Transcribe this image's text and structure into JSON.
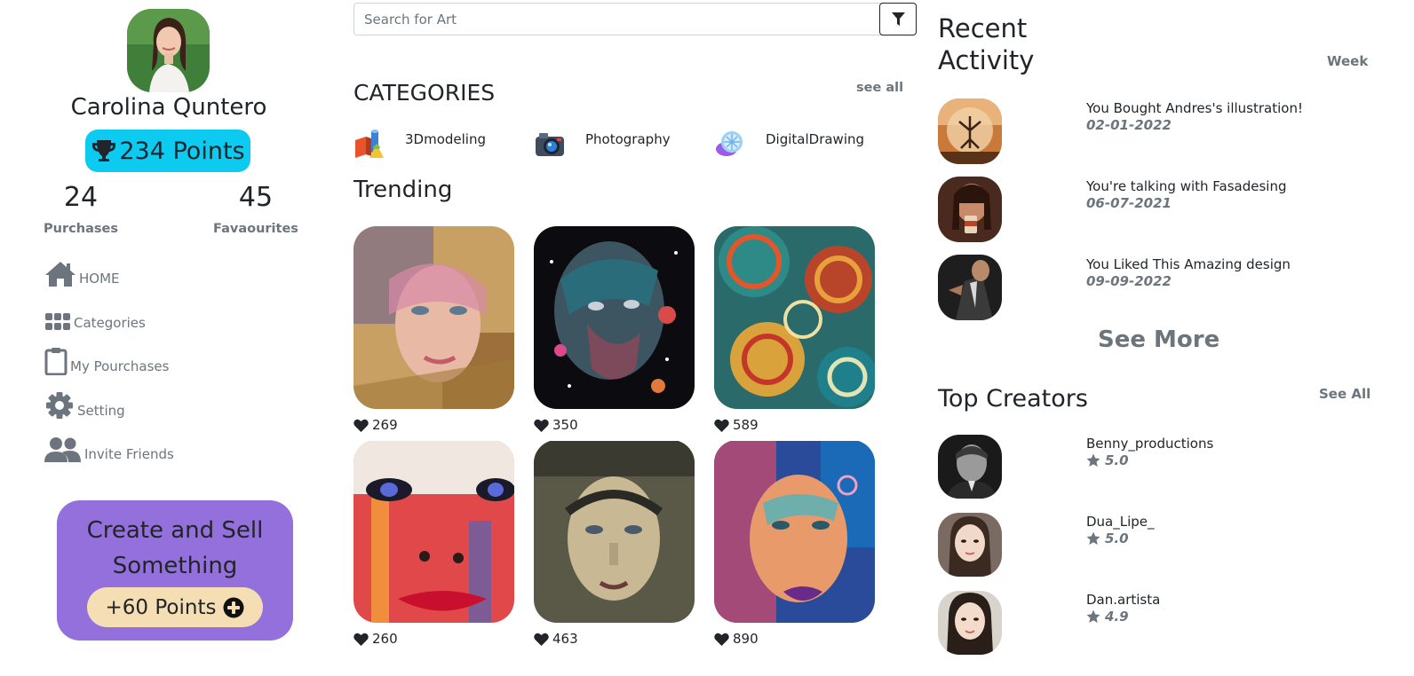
{
  "profile": {
    "name": "Carolina Quntero",
    "points_label": "234 Points",
    "purchases_count": "24",
    "purchases_label": "Purchases",
    "favourites_count": "45",
    "favourites_label": "Favaourites"
  },
  "nav": [
    {
      "label": "HOME",
      "icon": "home-icon"
    },
    {
      "label": "Categories",
      "icon": "grid-icon"
    },
    {
      "label": "My Pourchases",
      "icon": "clipboard-icon"
    },
    {
      "label": "Setting",
      "icon": "gear-icon"
    },
    {
      "label": "Invite Friends",
      "icon": "users-icon"
    }
  ],
  "promo": {
    "line1": "Create and Sell",
    "line2": "Something",
    "button_label": "+60 Points"
  },
  "search": {
    "placeholder": "Search for Art"
  },
  "categories": {
    "title": "CATEGORIES",
    "see_all": "see all",
    "items": [
      {
        "label": "3Dmodeling",
        "icon": "3d-shapes-icon"
      },
      {
        "label": "Photography",
        "icon": "camera-icon"
      },
      {
        "label": "DigitalDrawing",
        "icon": "drawing-tablet-icon"
      }
    ]
  },
  "trending": {
    "title": "Trending",
    "items": [
      {
        "likes": "269"
      },
      {
        "likes": "350"
      },
      {
        "likes": "589"
      },
      {
        "likes": "260"
      },
      {
        "likes": "463"
      },
      {
        "likes": "890"
      }
    ]
  },
  "recent_activity": {
    "title_line1": "Recent",
    "title_line2": "Activity",
    "period": "Week",
    "items": [
      {
        "title": "You Bought Andres's illustration!",
        "date": "02-01-2022"
      },
      {
        "title": "You're talking with Fasadesing",
        "date": "06-07-2021"
      },
      {
        "title": "You Liked This Amazing design",
        "date": "09-09-2022"
      }
    ],
    "see_more": "See More"
  },
  "top_creators": {
    "title": "Top Creators",
    "see_all": "See All",
    "items": [
      {
        "name": "Benny_productions",
        "rating": "5.0"
      },
      {
        "name": "Dua_Lipe_",
        "rating": "5.0"
      },
      {
        "name": "Dan.artista",
        "rating": "4.9"
      }
    ]
  },
  "colors": {
    "points_pill": "#0dcaf0",
    "promo_bg": "#9370db",
    "promo_button": "#f5deb3",
    "muted_text": "#6c757d"
  }
}
